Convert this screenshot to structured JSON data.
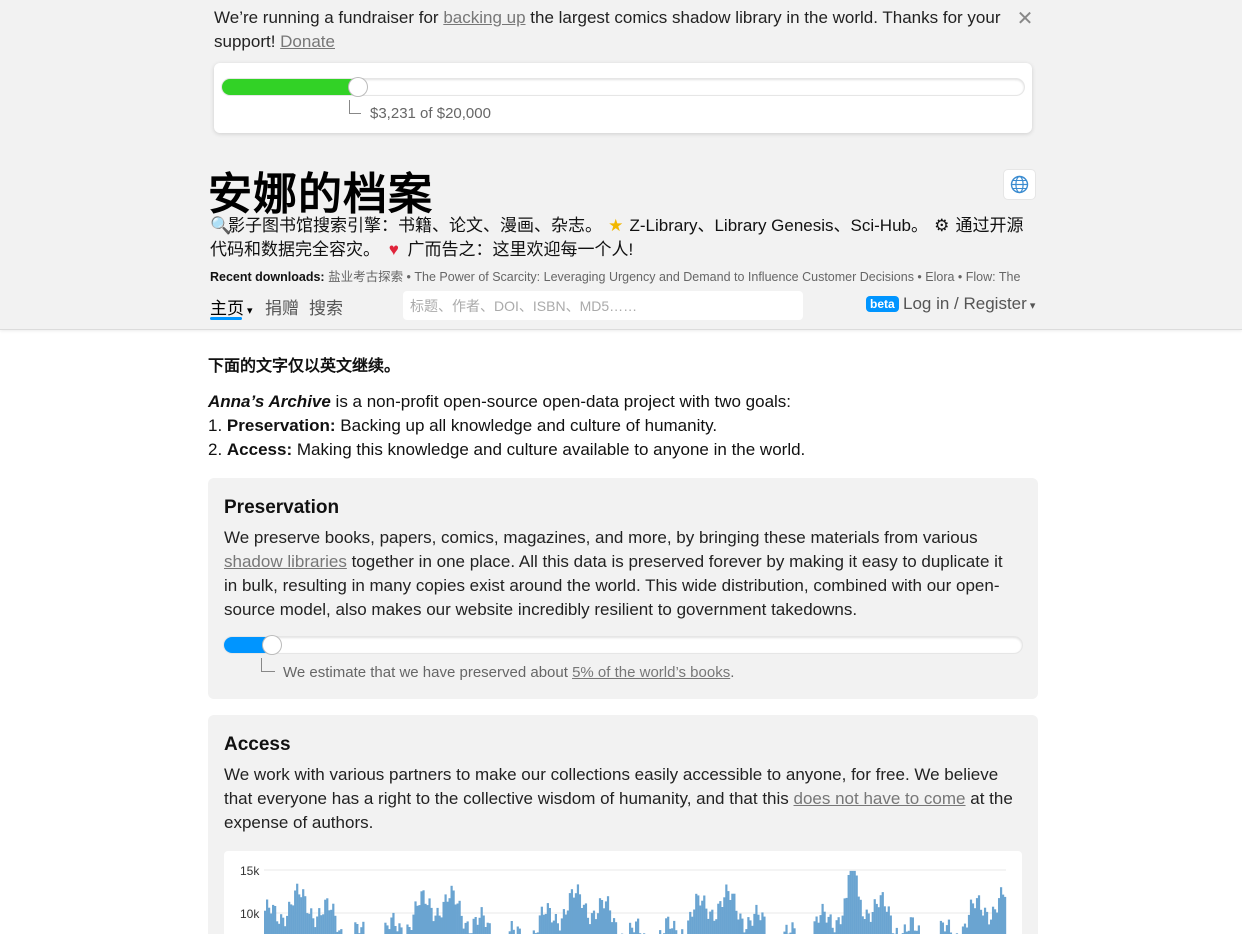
{
  "fundraiser": {
    "text_before": "We’re running a fundraiser for ",
    "link1": "backing up",
    "text_middle": " the largest comics shadow library in the world. Thanks for your support! ",
    "link2": "Donate",
    "progress_label": "$3,231 of $20,000",
    "raised": 3231,
    "goal": 20000,
    "progress_color": "#32d226"
  },
  "header": {
    "title": "安娜的档案",
    "tagline_1": "影子图书馆搜索引擎：书籍、论文、漫画、杂志。",
    "tagline_2": "Z-Library、Library Genesis、Sci-Hub。",
    "tagline_3": "通过开源代码和数据完全容灾。",
    "tagline_4": "广而告之：这里欢迎每一个人!",
    "recent_label": "Recent downloads:",
    "recent_items": "盐业考古探索 • The Power of Scarcity: Leveraging Urgency and Demand to Influence Customer Decisions • Elora • Flow: The"
  },
  "nav": {
    "home": "主页",
    "donate": "捐赠",
    "search": "搜索",
    "search_placeholder": "标题、作者、DOI、ISBN、MD5……",
    "beta": "beta",
    "login": "Log in / Register"
  },
  "main": {
    "note": "下面的文字仅以英文继续。",
    "intro_name": "Anna’s Archive",
    "intro_rest": " is a non-profit open-source open-data project with two goals:",
    "goal1_num": "1. ",
    "goal1_bold": "Preservation:",
    "goal1_text": " Backing up all knowledge and culture of humanity.",
    "goal2_num": "2. ",
    "goal2_bold": "Access:",
    "goal2_text": " Making this knowledge and culture available to anyone in the world."
  },
  "preservation": {
    "heading": "Preservation",
    "text_1": "We preserve books, papers, comics, magazines, and more, by bringing these materials from various ",
    "link": "shadow libraries",
    "text_2": " together in one place. All this data is preserved forever by making it easy to duplicate it in bulk, resulting in many copies exist around the world. This wide distribution, combined with our open-source model, also makes our website incredibly resilient to government takedowns.",
    "estimate_text": "We estimate that we have preserved about ",
    "estimate_link": "5% of the world’s books",
    "estimate_end": ".",
    "progress_percent": 5,
    "progress_color": "#0095ff"
  },
  "access": {
    "heading": "Access",
    "text_1": "We work with various partners to make our collections easily accessible to anyone, for free. We believe that everyone has a right to the collective wisdom of humanity, and that this ",
    "link": "does not have to come",
    "text_2": " at the expense of authors."
  },
  "chart_data": {
    "type": "bar",
    "y_ticks": [
      "15k",
      "10k"
    ],
    "ylim": [
      0,
      15000
    ],
    "color": "#6aa4d1",
    "grid": true
  }
}
